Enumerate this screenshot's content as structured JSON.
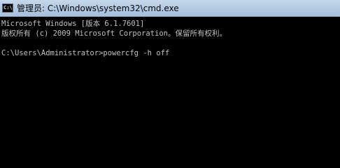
{
  "window": {
    "title": "管理员: C:\\Windows\\system32\\cmd.exe",
    "app_icon": "cmd-icon",
    "app_icon_text": "C:\\"
  },
  "console": {
    "lines": [
      "Microsoft Windows [版本 6.1.7601]",
      "版权所有 (c) 2009 Microsoft Corporation。保留所有权利。",
      "",
      "C:\\Users\\Administrator>powercfg -h off"
    ]
  },
  "colors": {
    "background": "#000000",
    "text": "#c0c0c0",
    "titlebar": "#b2c9e2"
  }
}
